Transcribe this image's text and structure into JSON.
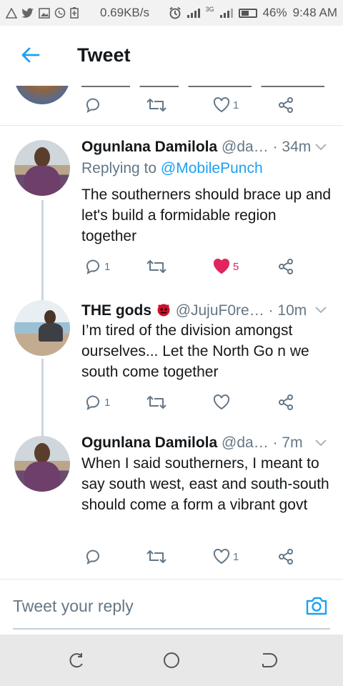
{
  "status_bar": {
    "speed": "0.69KB/s",
    "network": "3G",
    "battery": "46%",
    "time": "9:48 AM",
    "icons": [
      "warning-icon",
      "twitter-icon",
      "gallery-icon",
      "whatsapp-icon",
      "battery-saver-icon"
    ]
  },
  "header": {
    "title": "Tweet",
    "back_icon": "arrow-left-icon"
  },
  "partial_tweet": {
    "reply_count": "",
    "retweet_count": "",
    "like_count": "1"
  },
  "tweets": [
    {
      "name": "Ogunlana Damilola",
      "handle": "@da…",
      "time": "· 34m",
      "replying_prefix": "Replying to ",
      "replying_handle": "@MobilePunch",
      "text": "The southerners should brace up and let's build a formidable region together",
      "reply_count": "1",
      "retweet_count": "",
      "like_count": "5",
      "liked": true
    },
    {
      "name": "THE gods",
      "handle": "@JujuF0re…",
      "time": "· 10m",
      "text": "I’m tired of the division amongst ourselves... Let the North Go n we south come together",
      "reply_count": "1",
      "retweet_count": "",
      "like_count": "",
      "liked": false
    },
    {
      "name": "Ogunlana Damilola",
      "handle": "@da…",
      "time": "· 7m",
      "text": "When I said southerners, I meant to say south west, east and south-south should come a form a vibrant govt",
      "reply_count": "",
      "retweet_count": "",
      "like_count": "1",
      "liked": false
    }
  ],
  "reply_bar": {
    "placeholder": "Tweet your reply"
  },
  "colors": {
    "accent": "#1da1f2",
    "like": "#e0245e",
    "muted": "#657786",
    "text": "#14171a"
  }
}
